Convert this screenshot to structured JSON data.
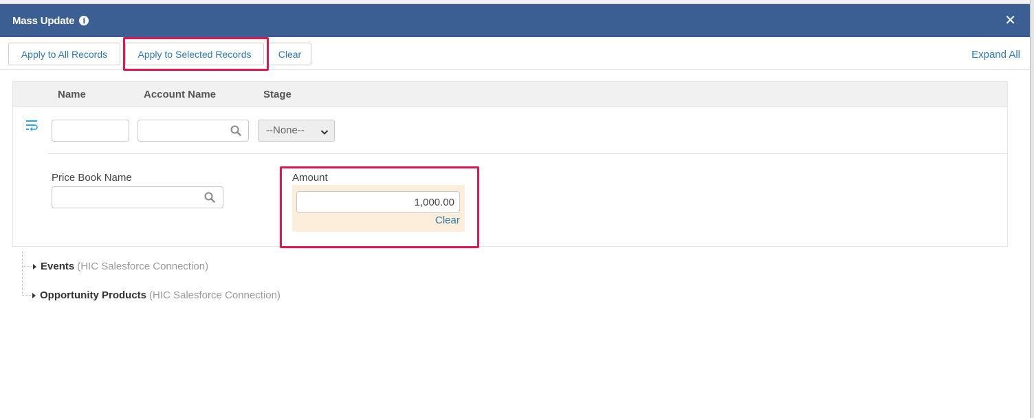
{
  "modal": {
    "title": "Mass Update",
    "info_icon": "info-circle-icon",
    "close_icon": "close-icon"
  },
  "toolbar": {
    "apply_all_label": "Apply to All Records",
    "apply_selected_label": "Apply to Selected Records",
    "clear_label": "Clear",
    "expand_all_label": "Expand All"
  },
  "panel": {
    "columns": [
      "Name",
      "Account Name",
      "Stage"
    ],
    "wrap_icon": "text-wrap-icon",
    "name_value": "",
    "account_name_value": "",
    "stage_selected": "--None--",
    "price_book_label": "Price Book Name",
    "price_book_value": "",
    "amount_label": "Amount",
    "amount_value": "1,000.00",
    "amount_clear_label": "Clear"
  },
  "tree": [
    {
      "label": "Events",
      "sub": "(HIC Salesforce Connection)"
    },
    {
      "label": "Opportunity Products",
      "sub": "(HIC Salesforce Connection)"
    }
  ],
  "colors": {
    "header_bg": "#3b5f92",
    "link": "#2a7ab0",
    "highlight": "#e0164f",
    "amount_bg": "#fdeedb"
  }
}
